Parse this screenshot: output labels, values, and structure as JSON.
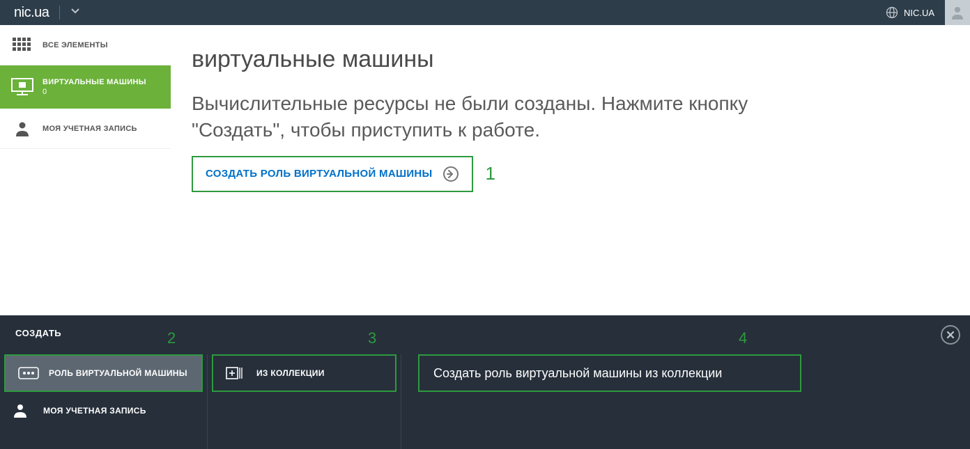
{
  "header": {
    "logo": "nic.ua",
    "org": "NIC.UA"
  },
  "sidebar": {
    "items": [
      {
        "label": "ВСЕ ЭЛЕМЕНТЫ"
      },
      {
        "label": "ВИРТУАЛЬНЫЕ МАШИНЫ",
        "count": "0"
      },
      {
        "label": "МОЯ УЧЕТНАЯ ЗАПИСЬ"
      }
    ]
  },
  "main": {
    "title": "виртуальные машины",
    "description": "Вычислительные ресурсы не были созданы. Нажмите кнопку \"Создать\", чтобы приступить к работе.",
    "create_button": "СОЗДАТЬ РОЛЬ ВИРТУАЛЬНОЙ МАШИНЫ"
  },
  "drawer": {
    "title": "СОЗДАТЬ",
    "col1": [
      {
        "label": "РОЛЬ ВИРТУАЛЬНОЙ МАШИНЫ",
        "highlighted": true
      },
      {
        "label": "МОЯ УЧЕТНАЯ ЗАПИСЬ"
      }
    ],
    "col2": [
      {
        "label": "ИЗ КОЛЛЕКЦИИ"
      }
    ],
    "col3_text": "Создать роль виртуальной машины из коллекции"
  },
  "annotations": {
    "a1": "1",
    "a2": "2",
    "a3": "3",
    "a4": "4"
  }
}
